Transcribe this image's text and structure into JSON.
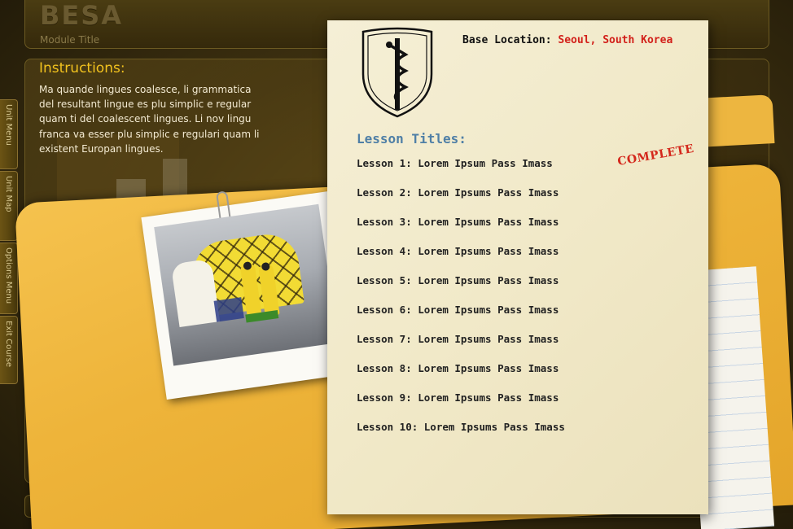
{
  "header": {
    "logo": "BESA",
    "module_title": "Module Title"
  },
  "instructions": {
    "title": "Instructions:",
    "text": "Ma quande lingues coalesce, li grammatica del resultant lingue es plu simplic e regular quam ti del coalescent lingues. Li nov lingu franca va esser plu simplic e regulari quam li existent Europan lingues."
  },
  "side_tabs": [
    {
      "label": "Unit Menu"
    },
    {
      "label": "Unit Map"
    },
    {
      "label": "Options Menu"
    },
    {
      "label": "Exit Course"
    }
  ],
  "paper": {
    "base_location_label": "Base Location:",
    "base_location_value": "Seoul, South Korea",
    "lesson_titles_heading": "Lesson Titles:",
    "complete_stamp": "COMPLETE",
    "lessons": [
      {
        "label": "Lesson 1: Lorem Ipsum Pass Imass",
        "status": "complete"
      },
      {
        "label": "Lesson 2: Lorem Ipsums Pass Imass"
      },
      {
        "label": "Lesson 3: Lorem Ipsums Pass Imass"
      },
      {
        "label": "Lesson 4: Lorem Ipsums Pass Imass"
      },
      {
        "label": "Lesson 5: Lorem Ipsums Pass Imass"
      },
      {
        "label": "Lesson 6: Lorem Ipsums Pass Imass"
      },
      {
        "label": "Lesson 7: Lorem Ipsums Pass Imass"
      },
      {
        "label": "Lesson 8: Lorem Ipsums Pass Imass"
      },
      {
        "label": "Lesson 9: Lorem Ipsums Pass Imass"
      },
      {
        "label": "Lesson 10: Lorem Ipsums Pass Imass"
      }
    ]
  },
  "icons": {
    "emblem": "medical-caduceus-shield-icon",
    "photo": "hazmat-tent-photo"
  },
  "colors": {
    "accent_yellow": "#f2c21e",
    "location_red": "#d2201a",
    "heading_blue": "#4f7fa6",
    "folder": "#eeb43a"
  }
}
